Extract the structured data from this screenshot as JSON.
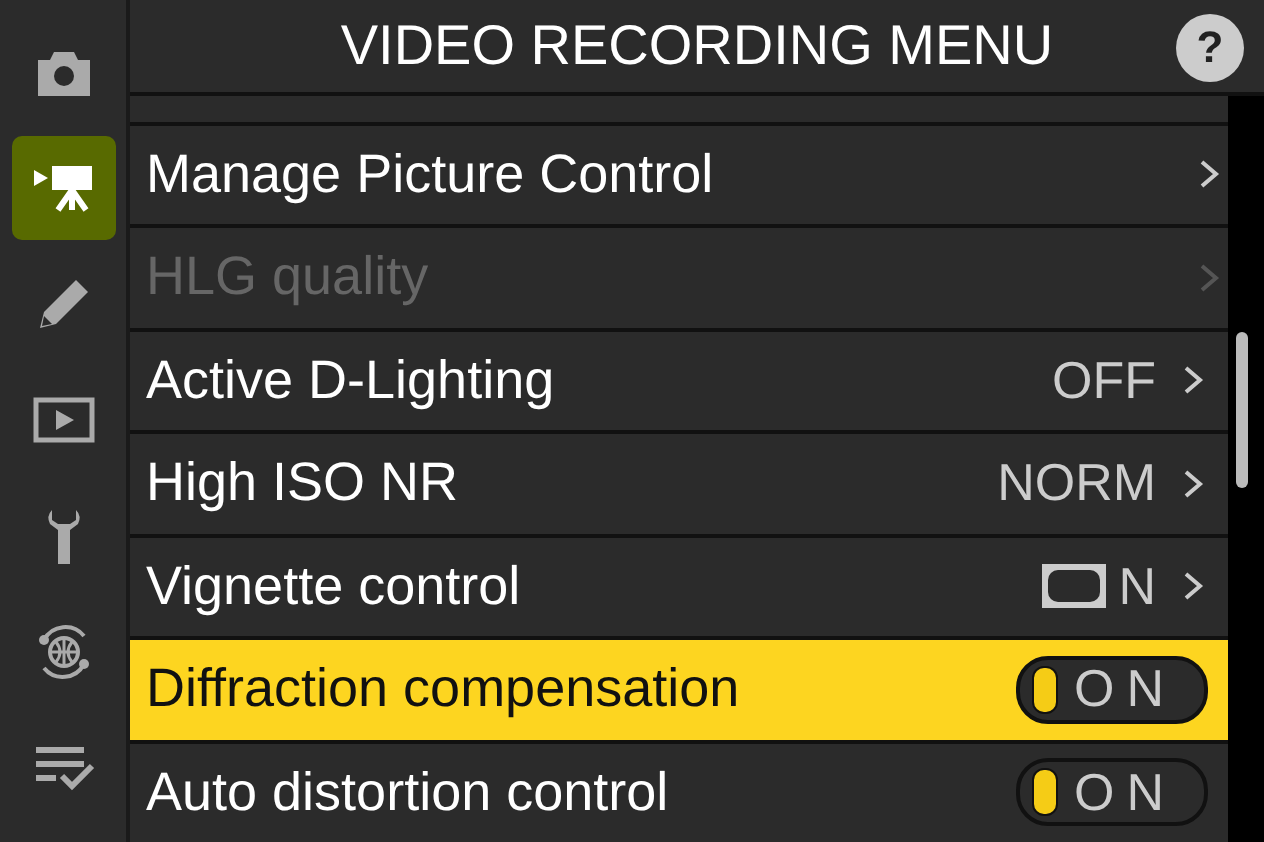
{
  "sidebar": {
    "items": [
      {
        "kind": "camera",
        "selected": false
      },
      {
        "kind": "video",
        "selected": true
      },
      {
        "kind": "pencil",
        "selected": false
      },
      {
        "kind": "playback",
        "selected": false
      },
      {
        "kind": "wrench",
        "selected": false
      },
      {
        "kind": "network",
        "selected": false
      },
      {
        "kind": "checklist",
        "selected": false
      }
    ]
  },
  "header": {
    "title": "VIDEO RECORDING MENU",
    "help": "?"
  },
  "menu": {
    "rows": [
      {
        "kind": "submenu",
        "label": "Manage Picture Control",
        "disabled": false,
        "selected": false
      },
      {
        "kind": "submenu",
        "label": "HLG quality",
        "disabled": true,
        "selected": false
      },
      {
        "kind": "submenu",
        "label": "Active D-Lighting",
        "value": "OFF",
        "disabled": false,
        "selected": false
      },
      {
        "kind": "submenu",
        "label": "High ISO NR",
        "value": "NORM",
        "disabled": false,
        "selected": false
      },
      {
        "kind": "submenu",
        "label": "Vignette control",
        "value": "N",
        "value_icon": true,
        "disabled": false,
        "selected": false
      },
      {
        "kind": "toggle",
        "label": "Diffraction compensation",
        "value": "ON",
        "on": true,
        "disabled": false,
        "selected": true
      },
      {
        "kind": "toggle",
        "label": "Auto distortion control",
        "value": "ON",
        "on": true,
        "disabled": false,
        "selected": false
      }
    ]
  }
}
